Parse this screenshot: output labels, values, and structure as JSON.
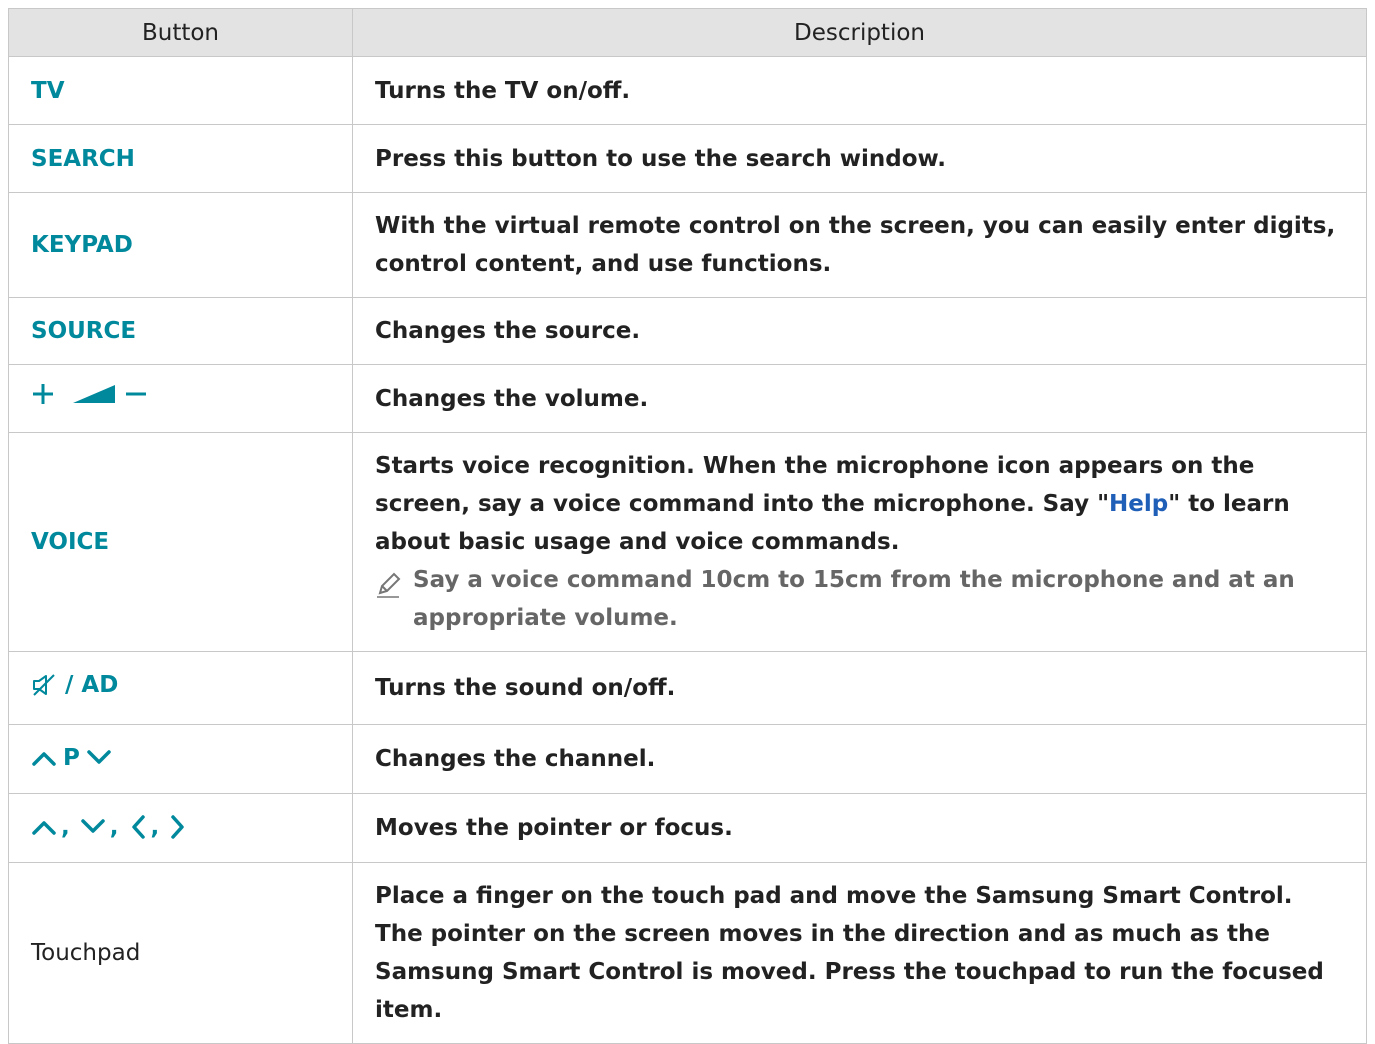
{
  "header": {
    "button": "Button",
    "description": "Description"
  },
  "rows": [
    {
      "button": "TV",
      "desc": "Turns the TV on/off."
    },
    {
      "button": "SEARCH",
      "desc": "Press this button to use the search window."
    },
    {
      "button": "KEYPAD",
      "desc": "With the virtual remote control on the screen, you can easily enter digits, control content, and use functions."
    },
    {
      "button": "SOURCE",
      "desc": "Changes the source."
    },
    {
      "button_icons": [
        "plus-icon",
        "volume-ramp-icon",
        "minus-icon"
      ],
      "desc": "Changes the volume."
    },
    {
      "button": "VOICE",
      "desc_before": "Starts voice recognition. When the microphone icon appears on the screen, say a voice command into the microphone. Say \"",
      "desc_link": "Help",
      "desc_after": "\" to learn about basic usage and voice commands.",
      "note": "Say a voice command 10cm to 15cm from the microphone and at an appropriate volume."
    },
    {
      "button": "/ AD",
      "button_icon": "mute-icon",
      "desc": "Turns the sound on/off."
    },
    {
      "button": "P",
      "button_icons": [
        "chevron-up-icon",
        "chevron-down-icon"
      ],
      "desc": "Changes the channel."
    },
    {
      "button": ",",
      "button_icons": [
        "chevron-up-icon",
        "chevron-down-icon",
        "chevron-left-icon",
        "chevron-right-icon"
      ],
      "desc": "Moves the pointer or focus."
    },
    {
      "button": "Touchpad",
      "desc": "Place a finger on the touch pad and move the Samsung Smart Control. The pointer on the screen moves in the direction and as much as the Samsung Smart Control is moved. Press the touchpad to run the focused item."
    }
  ],
  "colors": {
    "accent": "#00889c",
    "link": "#1f5fb8",
    "header_bg": "#e3e3e3",
    "border": "#c8c8c8",
    "note": "#666666"
  }
}
